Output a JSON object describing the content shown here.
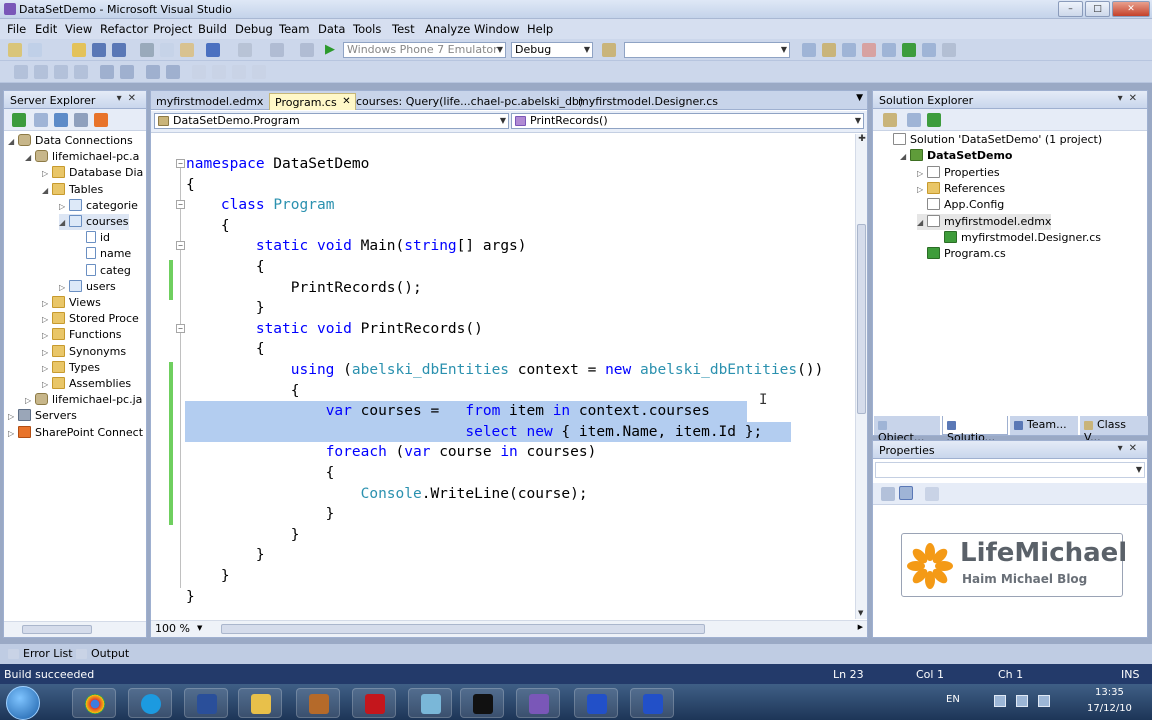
{
  "window": {
    "title": "DataSetDemo - Microsoft Visual Studio",
    "controls": [
      "–",
      "□",
      "✕"
    ]
  },
  "menu": [
    "File",
    "Edit",
    "View",
    "Refactor",
    "Project",
    "Build",
    "Debug",
    "Team",
    "Data",
    "Tools",
    "Test",
    "Analyze",
    "Window",
    "Help"
  ],
  "toolbar": {
    "target": "Windows Phone 7 Emulator",
    "config": "Debug",
    "find": ""
  },
  "server_explorer": {
    "title": "Server Explorer",
    "items": [
      {
        "label": "Data Connections",
        "icon": "database-icon",
        "indent": 0
      },
      {
        "label": "lifemichael-pc.a",
        "icon": "db-icon",
        "indent": 1
      },
      {
        "label": "Database Dia",
        "icon": "folder-icon",
        "indent": 2
      },
      {
        "label": "Tables",
        "icon": "folder-icon",
        "indent": 2
      },
      {
        "label": "categorie",
        "icon": "table-icon",
        "indent": 3
      },
      {
        "label": "courses",
        "icon": "table-icon",
        "indent": 3
      },
      {
        "label": "id",
        "icon": "column-icon",
        "indent": 4
      },
      {
        "label": "name",
        "icon": "column-icon",
        "indent": 4
      },
      {
        "label": "categ",
        "icon": "column-icon",
        "indent": 4
      },
      {
        "label": "users",
        "icon": "table-icon",
        "indent": 3
      },
      {
        "label": "Views",
        "icon": "folder-icon",
        "indent": 2
      },
      {
        "label": "Stored Proce",
        "icon": "folder-icon",
        "indent": 2
      },
      {
        "label": "Functions",
        "icon": "folder-icon",
        "indent": 2
      },
      {
        "label": "Synonyms",
        "icon": "folder-icon",
        "indent": 2
      },
      {
        "label": "Types",
        "icon": "folder-icon",
        "indent": 2
      },
      {
        "label": "Assemblies",
        "icon": "folder-icon",
        "indent": 2
      },
      {
        "label": "lifemichael-pc.ja",
        "icon": "db-icon",
        "indent": 1
      },
      {
        "label": "Servers",
        "icon": "server-icon",
        "indent": 0
      },
      {
        "label": "SharePoint Connect",
        "icon": "sharepoint-icon",
        "indent": 0
      }
    ]
  },
  "editor": {
    "tabs": [
      "myfirstmodel.edmx",
      "Program.cs",
      "courses: Query(life...chael-pc.abelski_db)",
      "myfirstmodel.Designer.cs"
    ],
    "nav_left": "DataSetDemo.Program",
    "nav_right": "PrintRecords()",
    "zoom": "100 %",
    "code": [
      "namespace DataSetDemo",
      "{",
      "    class Program",
      "    {",
      "        static void Main(string[] args)",
      "        {",
      "            PrintRecords();",
      "        }",
      "        static void PrintRecords()",
      "        {",
      "            using (abelski_dbEntities context = new abelski_dbEntities())",
      "            {",
      "                var courses =   from item in context.courses",
      "                                select new { item.Name, item.Id };",
      "                foreach (var course in courses)",
      "                {",
      "                    Console.WriteLine(course);",
      "                }",
      "            }",
      "        }",
      "    }",
      "}"
    ]
  },
  "solution_explorer": {
    "title": "Solution Explorer",
    "items": [
      {
        "label": "Solution 'DataSetDemo' (1 project)",
        "indent": 0
      },
      {
        "label": "DataSetDemo",
        "indent": 1
      },
      {
        "label": "Properties",
        "indent": 2
      },
      {
        "label": "References",
        "indent": 2
      },
      {
        "label": "App.Config",
        "indent": 2
      },
      {
        "label": "myfirstmodel.edmx",
        "indent": 2
      },
      {
        "label": "myfirstmodel.Designer.cs",
        "indent": 3
      },
      {
        "label": "Program.cs",
        "indent": 2
      }
    ],
    "bottom_tabs": [
      "Object...",
      "Solutio...",
      "Team...",
      "Class V..."
    ]
  },
  "properties": {
    "title": "Properties"
  },
  "logo": {
    "name": "LifeMichael",
    "tagline": "Haim Michael Blog"
  },
  "bottom_tabs": [
    "Error List",
    "Output"
  ],
  "status": {
    "message": "Build succeeded",
    "ln": "Ln 23",
    "col": "Col 1",
    "ch": "Ch 1",
    "mode": "INS"
  },
  "taskbar": {
    "lang": "EN",
    "time": "13:35",
    "date": "17/12/10"
  }
}
